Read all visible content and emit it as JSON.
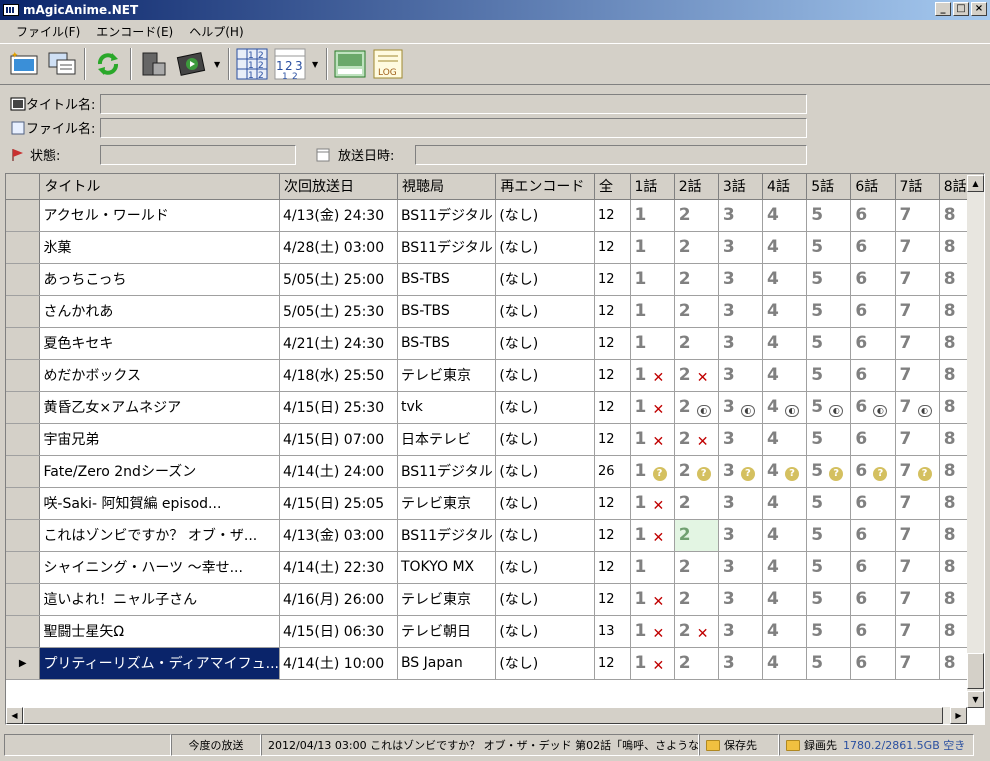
{
  "window": {
    "title": "mAgicAnime.NET"
  },
  "menu": [
    "ファイル(F)",
    "エンコード(E)",
    "ヘルプ(H)"
  ],
  "toolbar": {
    "icons": [
      "new-program-icon",
      "import-icon",
      "refresh-icon",
      "encoder-icon",
      "record-play-icon",
      "view-mode-icon",
      "episode-numbers-icon",
      "schedule-icon",
      "log-icon"
    ],
    "log_label": "LOG"
  },
  "fields": {
    "title_label": "タイトル名:",
    "file_label": "ファイル名:",
    "state_label": "状態:",
    "date_label": "放送日時:",
    "title_value": "",
    "file_value": "",
    "state_value": "",
    "date_value": ""
  },
  "columns": [
    "タイトル",
    "次回放送日",
    "視聴局",
    "再エンコード",
    "全",
    "1話",
    "2話",
    "3話",
    "4話",
    "5話",
    "6話",
    "7話",
    "8話"
  ],
  "rows": [
    {
      "title": "アクセル・ワールド",
      "next": "4/13(金) 24:30",
      "station": "BS11デジタル",
      "reenc": "(なし)",
      "total": "12",
      "marks": [
        "",
        "",
        "",
        "",
        "",
        "",
        "",
        ""
      ]
    },
    {
      "title": "氷菓",
      "next": "4/28(土) 03:00",
      "station": "BS11デジタル",
      "reenc": "(なし)",
      "total": "12",
      "marks": [
        "",
        "",
        "",
        "",
        "",
        "",
        "",
        ""
      ]
    },
    {
      "title": "あっちこっち",
      "next": "5/05(土) 25:00",
      "station": "BS-TBS",
      "reenc": "(なし)",
      "total": "12",
      "marks": [
        "",
        "",
        "",
        "",
        "",
        "",
        "",
        ""
      ]
    },
    {
      "title": "さんかれあ",
      "next": "5/05(土) 25:30",
      "station": "BS-TBS",
      "reenc": "(なし)",
      "total": "12",
      "marks": [
        "",
        "",
        "",
        "",
        "",
        "",
        "",
        ""
      ]
    },
    {
      "title": "夏色キセキ",
      "next": "4/21(土) 24:30",
      "station": "BS-TBS",
      "reenc": "(なし)",
      "total": "12",
      "marks": [
        "",
        "",
        "",
        "",
        "",
        "",
        "",
        ""
      ]
    },
    {
      "title": "めだかボックス",
      "next": "4/18(水) 25:50",
      "station": "テレビ東京",
      "reenc": "(なし)",
      "total": "12",
      "marks": [
        "x",
        "x",
        "",
        "",
        "",
        "",
        "",
        ""
      ]
    },
    {
      "title": "黄昏乙女×アムネジア",
      "next": "4/15(日) 25:30",
      "station": "tvk",
      "reenc": "(なし)",
      "total": "12",
      "marks": [
        "x",
        "r",
        "r",
        "r",
        "r",
        "r",
        "r",
        ""
      ]
    },
    {
      "title": "宇宙兄弟",
      "next": "4/15(日) 07:00",
      "station": "日本テレビ",
      "reenc": "(なし)",
      "total": "12",
      "marks": [
        "x",
        "x",
        "",
        "",
        "",
        "",
        "",
        ""
      ]
    },
    {
      "title": "Fate/Zero 2ndシーズン",
      "next": "4/14(土) 24:00",
      "station": "BS11デジタル",
      "reenc": "(なし)",
      "total": "26",
      "marks": [
        "q",
        "q",
        "q",
        "q",
        "q",
        "q",
        "q",
        ""
      ]
    },
    {
      "title": "咲-Saki- 阿知賀編 episod...",
      "next": "4/15(日) 25:05",
      "station": "テレビ東京",
      "reenc": "(なし)",
      "total": "12",
      "marks": [
        "x",
        "",
        "",
        "",
        "",
        "",
        "",
        ""
      ]
    },
    {
      "title": "これはゾンビですか？ オブ・ザ...",
      "next": "4/13(金) 03:00",
      "station": "BS11デジタル",
      "reenc": "(なし)",
      "total": "12",
      "marks": [
        "x",
        "hl",
        "",
        "",
        "",
        "",
        "",
        ""
      ]
    },
    {
      "title": "シャイニング・ハーツ 〜幸せ...",
      "next": "4/14(土) 22:30",
      "station": "TOKYO MX",
      "reenc": "(なし)",
      "total": "12",
      "marks": [
        "",
        "",
        "",
        "",
        "",
        "",
        "",
        ""
      ]
    },
    {
      "title": "這いよれ！ニャル子さん",
      "next": "4/16(月) 26:00",
      "station": "テレビ東京",
      "reenc": "(なし)",
      "total": "12",
      "marks": [
        "x",
        "",
        "",
        "",
        "",
        "",
        "",
        ""
      ]
    },
    {
      "title": "聖闘士星矢Ω",
      "next": "4/15(日) 06:30",
      "station": "テレビ朝日",
      "reenc": "(なし)",
      "total": "13",
      "marks": [
        "x",
        "x",
        "",
        "",
        "",
        "",
        "",
        ""
      ]
    },
    {
      "title": "プリティーリズム・ディアマイフュ...",
      "next": "4/14(土) 10:00",
      "station": "BS Japan",
      "reenc": "(なし)",
      "total": "12",
      "marks": [
        "x",
        "",
        "",
        "",
        "",
        "",
        "",
        ""
      ],
      "selected": true
    }
  ],
  "status": {
    "label": "今度の放送",
    "next_broadcast": "2012/04/13 03:00 これはゾンビですか？ オブ・ザ・デッド 第02話「嗚呼、さようなら俺」",
    "save_folder": "保存先",
    "record_folder": "録画先",
    "disk": "1780.2/2861.5GB 空き"
  }
}
